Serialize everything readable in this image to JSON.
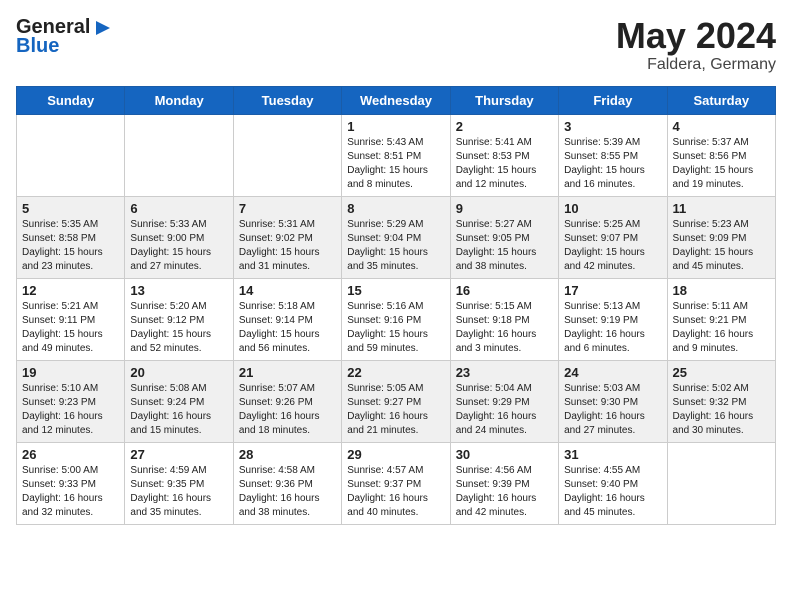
{
  "header": {
    "logo_general": "General",
    "logo_blue": "Blue",
    "month": "May 2024",
    "location": "Faldera, Germany"
  },
  "days_of_week": [
    "Sunday",
    "Monday",
    "Tuesday",
    "Wednesday",
    "Thursday",
    "Friday",
    "Saturday"
  ],
  "weeks": [
    [
      {
        "day": "",
        "info": ""
      },
      {
        "day": "",
        "info": ""
      },
      {
        "day": "",
        "info": ""
      },
      {
        "day": "1",
        "info": "Sunrise: 5:43 AM\nSunset: 8:51 PM\nDaylight: 15 hours\nand 8 minutes."
      },
      {
        "day": "2",
        "info": "Sunrise: 5:41 AM\nSunset: 8:53 PM\nDaylight: 15 hours\nand 12 minutes."
      },
      {
        "day": "3",
        "info": "Sunrise: 5:39 AM\nSunset: 8:55 PM\nDaylight: 15 hours\nand 16 minutes."
      },
      {
        "day": "4",
        "info": "Sunrise: 5:37 AM\nSunset: 8:56 PM\nDaylight: 15 hours\nand 19 minutes."
      }
    ],
    [
      {
        "day": "5",
        "info": "Sunrise: 5:35 AM\nSunset: 8:58 PM\nDaylight: 15 hours\nand 23 minutes."
      },
      {
        "day": "6",
        "info": "Sunrise: 5:33 AM\nSunset: 9:00 PM\nDaylight: 15 hours\nand 27 minutes."
      },
      {
        "day": "7",
        "info": "Sunrise: 5:31 AM\nSunset: 9:02 PM\nDaylight: 15 hours\nand 31 minutes."
      },
      {
        "day": "8",
        "info": "Sunrise: 5:29 AM\nSunset: 9:04 PM\nDaylight: 15 hours\nand 35 minutes."
      },
      {
        "day": "9",
        "info": "Sunrise: 5:27 AM\nSunset: 9:05 PM\nDaylight: 15 hours\nand 38 minutes."
      },
      {
        "day": "10",
        "info": "Sunrise: 5:25 AM\nSunset: 9:07 PM\nDaylight: 15 hours\nand 42 minutes."
      },
      {
        "day": "11",
        "info": "Sunrise: 5:23 AM\nSunset: 9:09 PM\nDaylight: 15 hours\nand 45 minutes."
      }
    ],
    [
      {
        "day": "12",
        "info": "Sunrise: 5:21 AM\nSunset: 9:11 PM\nDaylight: 15 hours\nand 49 minutes."
      },
      {
        "day": "13",
        "info": "Sunrise: 5:20 AM\nSunset: 9:12 PM\nDaylight: 15 hours\nand 52 minutes."
      },
      {
        "day": "14",
        "info": "Sunrise: 5:18 AM\nSunset: 9:14 PM\nDaylight: 15 hours\nand 56 minutes."
      },
      {
        "day": "15",
        "info": "Sunrise: 5:16 AM\nSunset: 9:16 PM\nDaylight: 15 hours\nand 59 minutes."
      },
      {
        "day": "16",
        "info": "Sunrise: 5:15 AM\nSunset: 9:18 PM\nDaylight: 16 hours\nand 3 minutes."
      },
      {
        "day": "17",
        "info": "Sunrise: 5:13 AM\nSunset: 9:19 PM\nDaylight: 16 hours\nand 6 minutes."
      },
      {
        "day": "18",
        "info": "Sunrise: 5:11 AM\nSunset: 9:21 PM\nDaylight: 16 hours\nand 9 minutes."
      }
    ],
    [
      {
        "day": "19",
        "info": "Sunrise: 5:10 AM\nSunset: 9:23 PM\nDaylight: 16 hours\nand 12 minutes."
      },
      {
        "day": "20",
        "info": "Sunrise: 5:08 AM\nSunset: 9:24 PM\nDaylight: 16 hours\nand 15 minutes."
      },
      {
        "day": "21",
        "info": "Sunrise: 5:07 AM\nSunset: 9:26 PM\nDaylight: 16 hours\nand 18 minutes."
      },
      {
        "day": "22",
        "info": "Sunrise: 5:05 AM\nSunset: 9:27 PM\nDaylight: 16 hours\nand 21 minutes."
      },
      {
        "day": "23",
        "info": "Sunrise: 5:04 AM\nSunset: 9:29 PM\nDaylight: 16 hours\nand 24 minutes."
      },
      {
        "day": "24",
        "info": "Sunrise: 5:03 AM\nSunset: 9:30 PM\nDaylight: 16 hours\nand 27 minutes."
      },
      {
        "day": "25",
        "info": "Sunrise: 5:02 AM\nSunset: 9:32 PM\nDaylight: 16 hours\nand 30 minutes."
      }
    ],
    [
      {
        "day": "26",
        "info": "Sunrise: 5:00 AM\nSunset: 9:33 PM\nDaylight: 16 hours\nand 32 minutes."
      },
      {
        "day": "27",
        "info": "Sunrise: 4:59 AM\nSunset: 9:35 PM\nDaylight: 16 hours\nand 35 minutes."
      },
      {
        "day": "28",
        "info": "Sunrise: 4:58 AM\nSunset: 9:36 PM\nDaylight: 16 hours\nand 38 minutes."
      },
      {
        "day": "29",
        "info": "Sunrise: 4:57 AM\nSunset: 9:37 PM\nDaylight: 16 hours\nand 40 minutes."
      },
      {
        "day": "30",
        "info": "Sunrise: 4:56 AM\nSunset: 9:39 PM\nDaylight: 16 hours\nand 42 minutes."
      },
      {
        "day": "31",
        "info": "Sunrise: 4:55 AM\nSunset: 9:40 PM\nDaylight: 16 hours\nand 45 minutes."
      },
      {
        "day": "",
        "info": ""
      }
    ]
  ]
}
